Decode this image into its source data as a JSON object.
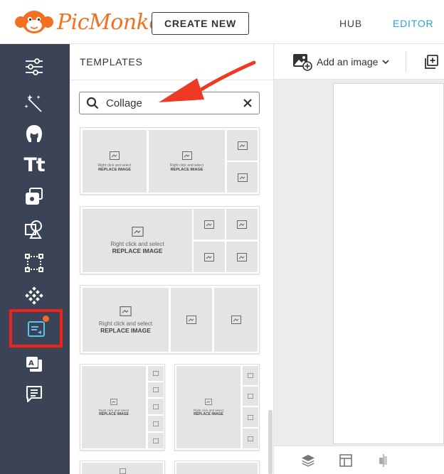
{
  "header": {
    "logo_text": "PicMonkey",
    "create_label": "CREATE NEW",
    "nav": {
      "hub": "HUB",
      "editor": "EDITOR"
    },
    "accent": "#f37021",
    "editor_active_color": "#2aa3d3"
  },
  "rail": {
    "items": [
      "adjustments-icon",
      "effects-wand-icon",
      "touch-up-icon",
      "text-icon",
      "overlays-icon",
      "graphics-icon",
      "frames-icon",
      "textures-icon",
      "templates-icon",
      "themes-icon",
      "comments-icon"
    ],
    "active": "templates-icon",
    "highlight_color": "#f0221b"
  },
  "panel": {
    "title": "TEMPLATES",
    "search": {
      "value": "Collage"
    },
    "placeholder_line1": "Right click and select",
    "placeholder_line2": "REPLACE IMAGE"
  },
  "editor": {
    "add_image_label": "Add an image"
  }
}
